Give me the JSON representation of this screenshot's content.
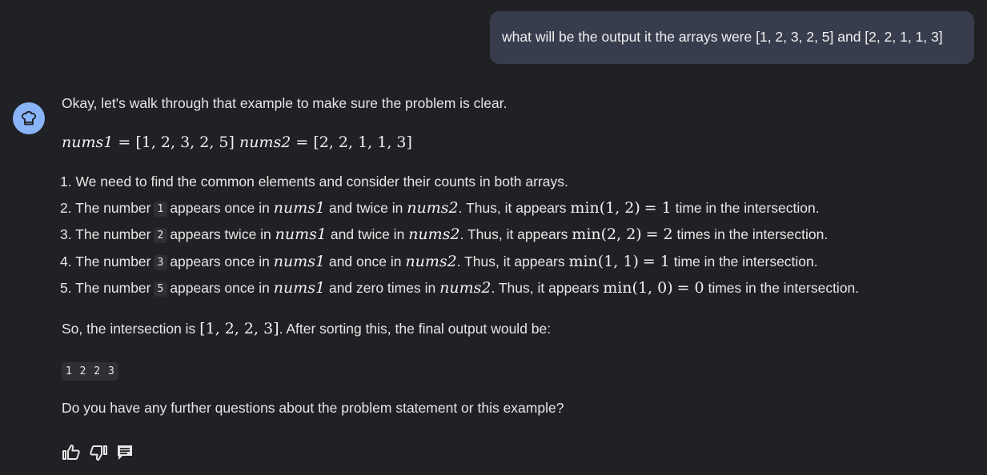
{
  "user": {
    "message": "what will be the output it the arrays were [1, 2, 3, 2, 5] and [2, 2, 1, 1, 3]"
  },
  "assistant": {
    "avatar_icon": "chef-hat-icon",
    "intro": "Okay, let's walk through that example to make sure the problem is clear.",
    "nums1_name": "nums1",
    "nums1_value": "[1, 2, 3, 2, 5]",
    "nums2_name": "nums2",
    "nums2_value": "[2, 2, 1, 1, 3]",
    "steps": [
      {
        "prefix": "1. We need to find the common elements and consider their counts in both arrays."
      },
      {
        "prefix": "2. The number",
        "num": "1",
        "count1": "appears once in",
        "arr1": "nums1",
        "count2": "and twice in",
        "arr2": "nums2",
        "mid": ". Thus, it appears",
        "expr": "min(1, 2)",
        "result": "= 1",
        "suffix": "time in the intersection."
      },
      {
        "prefix": "3. The number",
        "num": "2",
        "count1": "appears twice in",
        "arr1": "nums1",
        "count2": "and twice in",
        "arr2": "nums2",
        "mid": ". Thus, it appears",
        "expr": "min(2, 2)",
        "result": "= 2",
        "suffix": "times in the intersection."
      },
      {
        "prefix": "4. The number",
        "num": "3",
        "count1": "appears once in",
        "arr1": "nums1",
        "count2": "and once in",
        "arr2": "nums2",
        "mid": ". Thus, it appears",
        "expr": "min(1, 1)",
        "result": "= 1",
        "suffix": "time in the intersection."
      },
      {
        "prefix": "5. The number",
        "num": "5",
        "count1": "appears once in",
        "arr1": "nums1",
        "count2": "and zero times in",
        "arr2": "nums2",
        "mid": ". Thus, it appears",
        "expr": "min(1, 0)",
        "result": "= 0",
        "suffix": "times in the intersection."
      }
    ],
    "conclusion_a": "So, the intersection is",
    "conclusion_math": "[1, 2, 2, 3]",
    "conclusion_b": ". After sorting this, the final output would be:",
    "output_code": "1 2 2 3",
    "followup": "Do you have any further questions about the problem statement or this example?"
  },
  "actions": {
    "like_icon": "thumbs-up-icon",
    "dislike_icon": "thumbs-down-icon",
    "comment_icon": "comment-icon"
  }
}
